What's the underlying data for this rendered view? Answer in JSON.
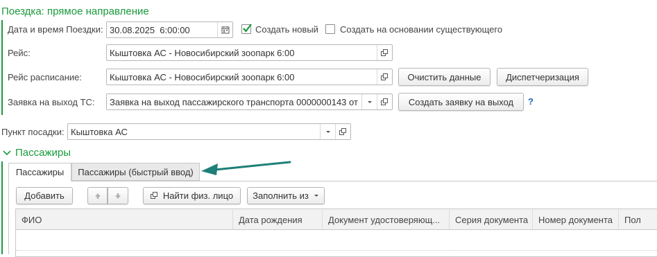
{
  "section_trip": {
    "title": "Поездка: прямое направление",
    "date_label": "Дата и время Поездки:",
    "date_value": "30.08.2025  6:00:00",
    "create_new_label": "Создать новый",
    "create_new_checked": true,
    "create_based_label": "Создать на основании существующего",
    "create_based_checked": false,
    "route_label": "Рейс:",
    "route_value": "Кыштовка АС - Новосибирский зоопарк 6:00",
    "schedule_label": "Рейс расписание:",
    "schedule_value": "Кыштовка АС - Новосибирский зоопарк 6:00",
    "clear_button": "Очистить данные",
    "dispatch_button": "Диспетчеризация",
    "request_label": "Заявка на выход ТС:",
    "request_value": "Заявка на выход пассажирского транспорта 0000000143 от",
    "create_request_button": "Создать заявку на выход",
    "help": "?"
  },
  "boarding": {
    "label": "Пункт посадки:",
    "value": "Кыштовка АС"
  },
  "passengers": {
    "title": "Пассажиры",
    "tabs": [
      {
        "label": "Пассажиры",
        "active": true
      },
      {
        "label": "Пассажиры (быстрый ввод)",
        "active": false
      }
    ],
    "toolbar": {
      "add": "Добавить",
      "find": "Найти физ. лицо",
      "fill": "Заполнить из"
    },
    "columns": [
      "ФИО",
      "Дата рождения",
      "Документ удостоверяющ...",
      "Серия документа",
      "Номер документа",
      "Пол"
    ]
  },
  "colors": {
    "accent_green": "#1a9a3c",
    "arrow_teal": "#1d7f77",
    "help_blue": "#1565c0"
  },
  "icons": {
    "calendar": "calendar-icon",
    "open": "open-form-icon",
    "dropdown": "dropdown-arrow-icon",
    "up": "arrow-up-icon",
    "down": "arrow-down-icon",
    "collapse": "chevron-down-icon",
    "checkbox_checked": "checkmark-icon"
  }
}
